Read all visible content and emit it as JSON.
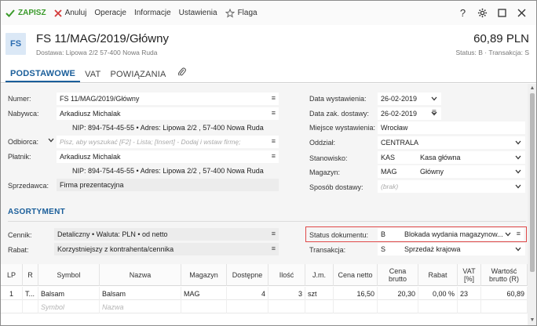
{
  "toolbar": {
    "save_label": "ZAPISZ",
    "cancel_label": "Anuluj",
    "operations_label": "Operacje",
    "info_label": "Informacje",
    "settings_label": "Ustawienia",
    "flag_label": "Flaga",
    "help_label": "?"
  },
  "header": {
    "icon_text": "FS",
    "title": "FS 11/MAG/2019/Główny",
    "subtitle": "Dostawa: Lipowa  2/2  57-400 Nowa Ruda",
    "amount": "60,89 PLN",
    "status_line": "Status: B  ·  Transakcja: S"
  },
  "tabs": [
    {
      "label": "PODSTAWOWE",
      "active": true
    },
    {
      "label": "VAT",
      "active": false
    },
    {
      "label": "POWIĄZANIA",
      "active": false
    }
  ],
  "left": {
    "numer_label": "Numer:",
    "numer_value": "FS 11/MAG/2019/Główny",
    "nabywca_label": "Nabywca:",
    "nabywca_value": "Arkadiusz Michalak",
    "nabywca_details": "NIP:  894-754-45-55  •  Adres:  Lipowa  2/2 , 57-400 Nowa Ruda",
    "odbiorca_label": "Odbiorca:",
    "odbiorca_placeholder": "Pisz, aby wyszukać [F2] - Lista; [Insert] - Dodaj i wstaw firmę;",
    "platnik_label": "Płatnik:",
    "platnik_value": "Arkadiusz Michalak",
    "platnik_details": "NIP:  894-754-45-55  •  Adres:  Lipowa  2/2 , 57-400 Nowa Ruda",
    "sprzedawca_label": "Sprzedawca:",
    "sprzedawca_value": "Firma prezentacyjna"
  },
  "right": {
    "data_wyst_label": "Data wystawienia:",
    "data_wyst_value": "26-02-2019",
    "data_zak_label": "Data zak. dostawy:",
    "data_zak_value": "26-02-2019",
    "miejsce_label": "Miejsce wystawienia:",
    "miejsce_value": "Wrocław",
    "oddzial_label": "Oddział:",
    "oddzial_value": "CENTRALA",
    "stanowisko_label": "Stanowisko:",
    "stanowisko_code": "KAS",
    "stanowisko_value": "Kasa główna",
    "magazyn_label": "Magazyn:",
    "magazyn_code": "MAG",
    "magazyn_value": "Główny",
    "sposob_label": "Sposób dostawy:",
    "sposob_placeholder": "(brak)"
  },
  "asortyment": {
    "title": "ASORTYMENT",
    "cennik_label": "Cennik:",
    "cennik_value": "Detaliczny • Waluta: PLN • od netto",
    "rabat_label": "Rabat:",
    "rabat_value": "Korzystniejszy z kontrahenta/cennika",
    "status_label": "Status dokumentu:",
    "status_code": "B",
    "status_value": "Blokada wydania magazynow...",
    "transakcja_label": "Transakcja:",
    "transakcja_code": "S",
    "transakcja_value": "Sprzedaż krajowa"
  },
  "table": {
    "headers": [
      "LP",
      "R",
      "Symbol",
      "Nazwa",
      "Magazyn",
      "Dostępne",
      "Ilość",
      "J.m.",
      "Cena netto",
      "Cena\nbrutto",
      "Rabat",
      "VAT\n[%]",
      "Wartość\nbrutto (R)"
    ],
    "row": {
      "lp": "1",
      "r": "T...",
      "symbol": "Balsam",
      "nazwa": "Balsam",
      "magazyn": "MAG",
      "dostepne": "4",
      "ilosc": "3",
      "jm": "szt",
      "cena_netto": "16,50",
      "cena_brutto": "20,30",
      "rabat": "0,00 %",
      "vat": "23",
      "wartosc": "60,89"
    },
    "new_row": {
      "symbol_placeholder": "Symbol",
      "nazwa_placeholder": "Nazwa"
    }
  },
  "colors": {
    "accent": "#1a5e9a",
    "save": "#3a9a2a",
    "cancel": "#d33a3a",
    "highlight_border": "#e04848"
  }
}
